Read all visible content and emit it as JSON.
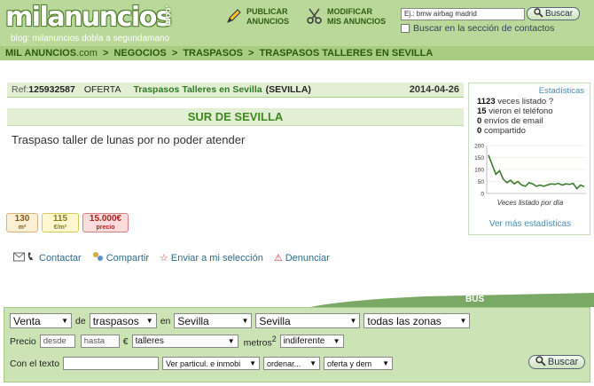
{
  "header": {
    "logo": "milanuncios",
    "logo_suffix": ".com",
    "blog": "blog: milanuncios dobla a segundamano",
    "publish_line1": "PUBLICAR",
    "publish_line2": "ANUNCIOS",
    "modify_line1": "MODIFICAR",
    "modify_line2": "MIS ANUNCIOS",
    "search_placeholder": "Ej.: bmw airbag madrid",
    "search_button": "Buscar",
    "contacts_checkbox": "Buscar en la sección de contactos"
  },
  "breadcrumb": {
    "site": "MIL ANUNCIOS",
    "site_suffix": ".com",
    "items": [
      "NEGOCIOS",
      "TRASPASOS",
      "TRASPASOS TALLERES EN SEVILLA"
    ]
  },
  "ad": {
    "ref_label": "Ref:",
    "ref_number": "125932587",
    "type": "OFERTA",
    "category": "Traspasos Talleres en Sevilla",
    "province": "(SEVILLA)",
    "date": "2014-04-26",
    "title": "SUR DE SEVILLA",
    "description": "Traspaso taller de lunas por no poder atender",
    "badges": [
      {
        "value": "130",
        "unit": "m²"
      },
      {
        "value": "115",
        "unit": "€/m²"
      },
      {
        "value": "15.000€",
        "unit": "precio"
      }
    ],
    "actions": {
      "contact": "Contactar",
      "share": "Compartir",
      "save": "Enviar a mi selección",
      "report": "Denunciar"
    }
  },
  "stats": {
    "title": "Estadísticas",
    "lines": [
      {
        "num": "1123",
        "text": "veces listado ?"
      },
      {
        "num": "15",
        "text": "vieron el teléfono"
      },
      {
        "num": "0",
        "text": "envíos de email"
      },
      {
        "num": "0",
        "text": "compartido"
      }
    ],
    "chart_caption": "Veces listado por día",
    "more_link": "Ver más estadísticas",
    "chart_data": {
      "type": "line",
      "y_ticks": [
        "200",
        "150",
        "100",
        "50",
        "0"
      ],
      "ylim": [
        0,
        200
      ],
      "values": [
        160,
        120,
        80,
        95,
        60,
        45,
        55,
        40,
        50,
        35,
        30,
        45,
        40,
        30,
        35,
        30,
        35,
        40,
        38,
        42,
        35,
        40,
        38,
        42,
        20,
        35,
        28
      ]
    }
  },
  "filter": {
    "banner": "BUS",
    "row1": {
      "operation": "Venta",
      "de": "de",
      "category": "traspasos",
      "en": "en",
      "region": "Sevilla",
      "city": "Sevilla",
      "zone": "todas las zonas"
    },
    "row2": {
      "price_label": "Precio",
      "from": "desde",
      "to": "hasta",
      "currency": "€",
      "subcategory": "talleres",
      "m2_label": "metros",
      "m2_sup": "2",
      "m2_value": "indiferente"
    },
    "row3": {
      "text_label": "Con el texto",
      "particular": "Ver particul. e inmobi",
      "order": "ordenar...",
      "kind": "oferta y dem",
      "search_button": "Buscar"
    }
  }
}
